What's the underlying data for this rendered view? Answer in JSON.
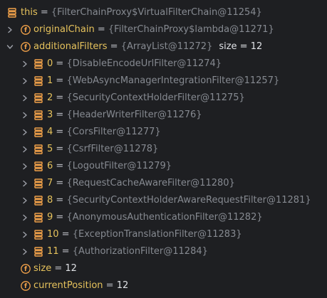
{
  "root": {
    "name": "this",
    "eq": " = ",
    "value": "{FilterChainProxy$VirtualFilterChain@11254}"
  },
  "original_chain": {
    "name": "originalChain",
    "eq": " = ",
    "value": "{FilterChainProxy$lambda@11271}"
  },
  "additional_filters": {
    "name": "additionalFilters",
    "eq": " = ",
    "value": "{ArrayList@11272}",
    "size_text": "size = 12"
  },
  "items": [
    {
      "index": "0",
      "eq": " = ",
      "value": "{DisableEncodeUrlFilter@11274}"
    },
    {
      "index": "1",
      "eq": " = ",
      "value": "{WebAsyncManagerIntegrationFilter@11257}"
    },
    {
      "index": "2",
      "eq": " = ",
      "value": "{SecurityContextHolderFilter@11275}"
    },
    {
      "index": "3",
      "eq": " = ",
      "value": "{HeaderWriterFilter@11276}"
    },
    {
      "index": "4",
      "eq": " = ",
      "value": "{CorsFilter@11277}"
    },
    {
      "index": "5",
      "eq": " = ",
      "value": "{CsrfFilter@11278}"
    },
    {
      "index": "6",
      "eq": " = ",
      "value": "{LogoutFilter@11279}"
    },
    {
      "index": "7",
      "eq": " = ",
      "value": "{RequestCacheAwareFilter@11280}"
    },
    {
      "index": "8",
      "eq": " = ",
      "value": "{SecurityContextHolderAwareRequestFilter@11281}"
    },
    {
      "index": "9",
      "eq": " = ",
      "value": "{AnonymousAuthenticationFilter@11282}"
    },
    {
      "index": "10",
      "eq": " = ",
      "value": "{ExceptionTranslationFilter@11283}"
    },
    {
      "index": "11",
      "eq": " = ",
      "value": "{AuthorizationFilter@11284}"
    }
  ],
  "size_field": {
    "name": "size",
    "eq": " = ",
    "value": "12"
  },
  "current_position": {
    "name": "currentPosition",
    "eq": " = ",
    "value": "12"
  },
  "icons": {
    "field": "field-icon",
    "element": "array-element-icon",
    "expand": "chevron-right-icon",
    "collapse": "chevron-down-icon"
  },
  "colors": {
    "background": "#1e1f22",
    "name": "#e6c25c",
    "value_gray": "#868a91",
    "icon_orange": "#f4a34a"
  }
}
